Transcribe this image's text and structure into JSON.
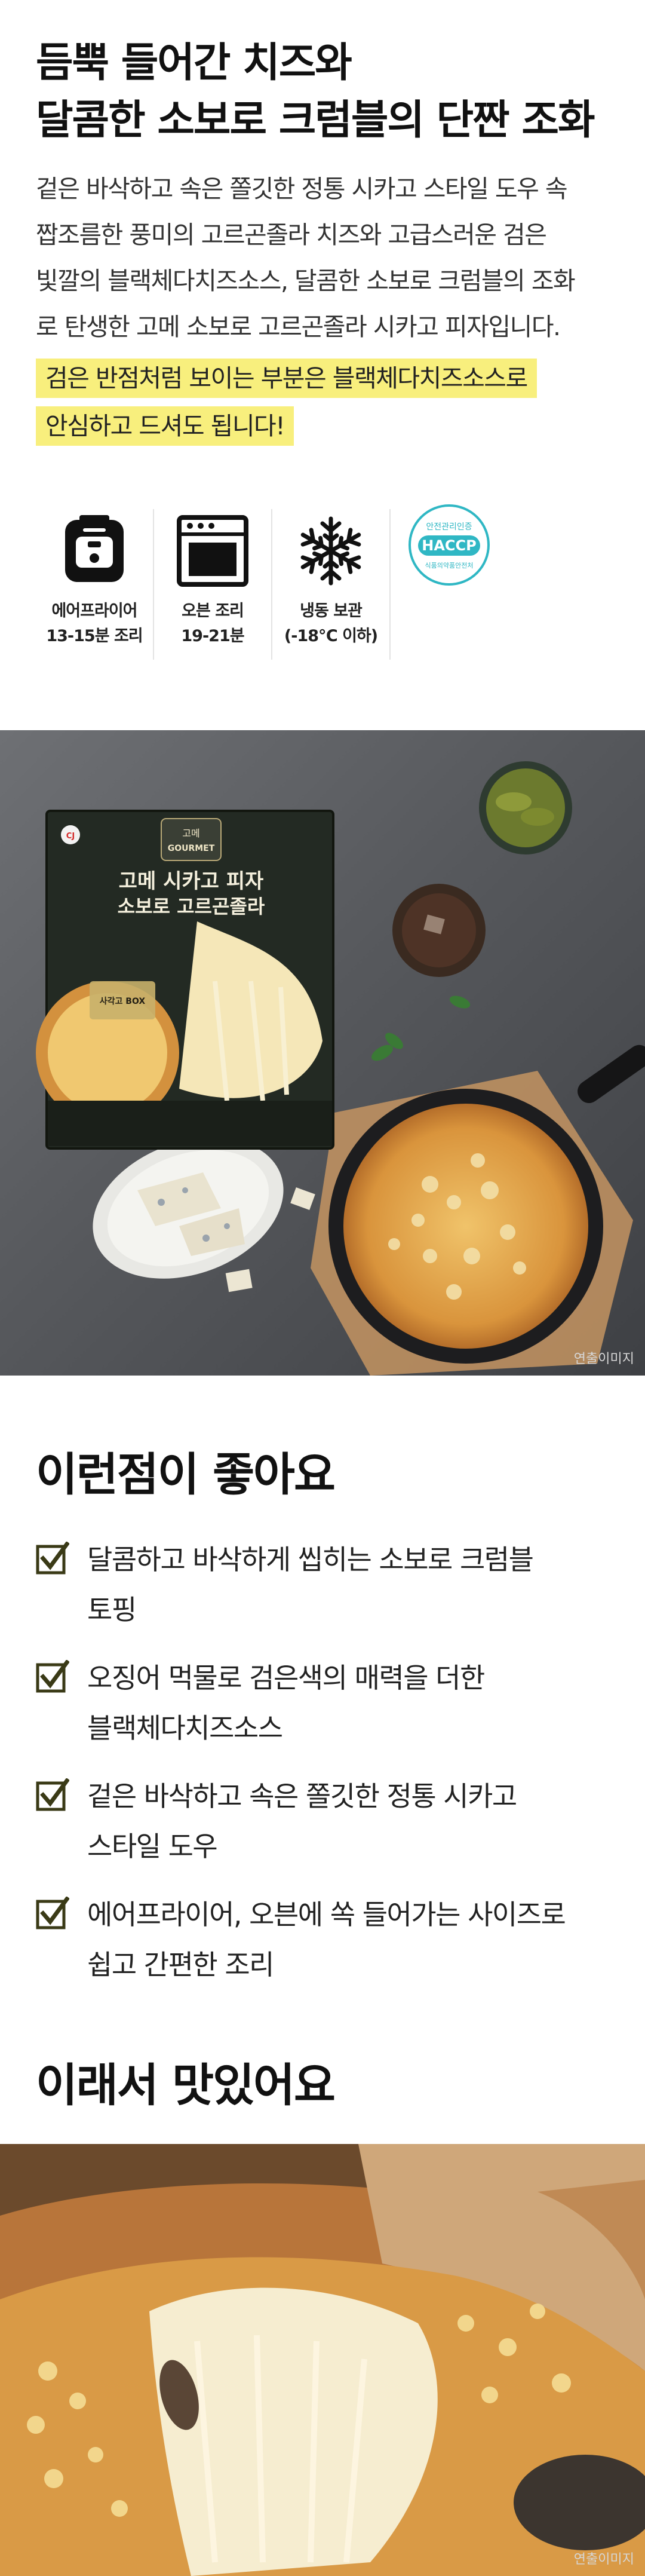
{
  "intro": {
    "headline_line1": "듬뿍 들어간 치즈와",
    "headline_line2": "달콤한 소보로 크럼블의 단짠 조화",
    "desc_lines": [
      "겉은 바삭하고 속은 쫄깃한 정통 시카고 스타일 도우 속",
      "짭조름한 풍미의 고르곤졸라 치즈와 고급스러운 검은",
      "빛깔의 블랙체다치즈소스, 달콤한 소보로 크럼블의 조화",
      "로 탄생한 고메 소보로 고르곤졸라 시카고 피자입니다."
    ],
    "highlight_lines": [
      "검은 반점처럼 보이는 부분은 블랙체다치즈소스로",
      "안심하고 드셔도 됩니다!"
    ]
  },
  "cooking_icons": [
    {
      "name": "air-fryer",
      "line1": "에어프라이어",
      "line2": "13-15분 조리"
    },
    {
      "name": "oven",
      "line1": "오븐 조리",
      "line2": "19-21분"
    },
    {
      "name": "snowflake",
      "line1": "냉동 보관",
      "line2": "(-18℃ 이하)"
    }
  ],
  "haccp": {
    "top_text": "안전관리인증",
    "main_text": "HACCP",
    "bottom_text": "식품의약품안전처"
  },
  "photo1": {
    "caption": "연출이미지",
    "box_brand": "CJ",
    "box_logo_line1": "고메",
    "box_logo_line2": "GOURMET",
    "box_title_line1": "고메 시카고 피자",
    "box_title_line2": "소보로 고르곤졸라",
    "box_badge": "사각고 BOX"
  },
  "good_points": {
    "title": "이런점이 좋아요",
    "items": [
      [
        "달콤하고 바삭하게 씹히는 소보로 크럼블",
        "토핑"
      ],
      [
        "오징어 먹물로 검은색의 매력을 더한",
        "블랙체다치즈소스"
      ],
      [
        "겉은 바삭하고 속은 쫄깃한 정통 시카고",
        "스타일 도우"
      ],
      [
        "에어프라이어, 오븐에 쏙 들어가는 사이즈로",
        "쉽고 간편한 조리"
      ]
    ],
    "check_color": "#3a3a16"
  },
  "tasty": {
    "title": "이래서 맛있어요",
    "caption": "연출이미지"
  }
}
